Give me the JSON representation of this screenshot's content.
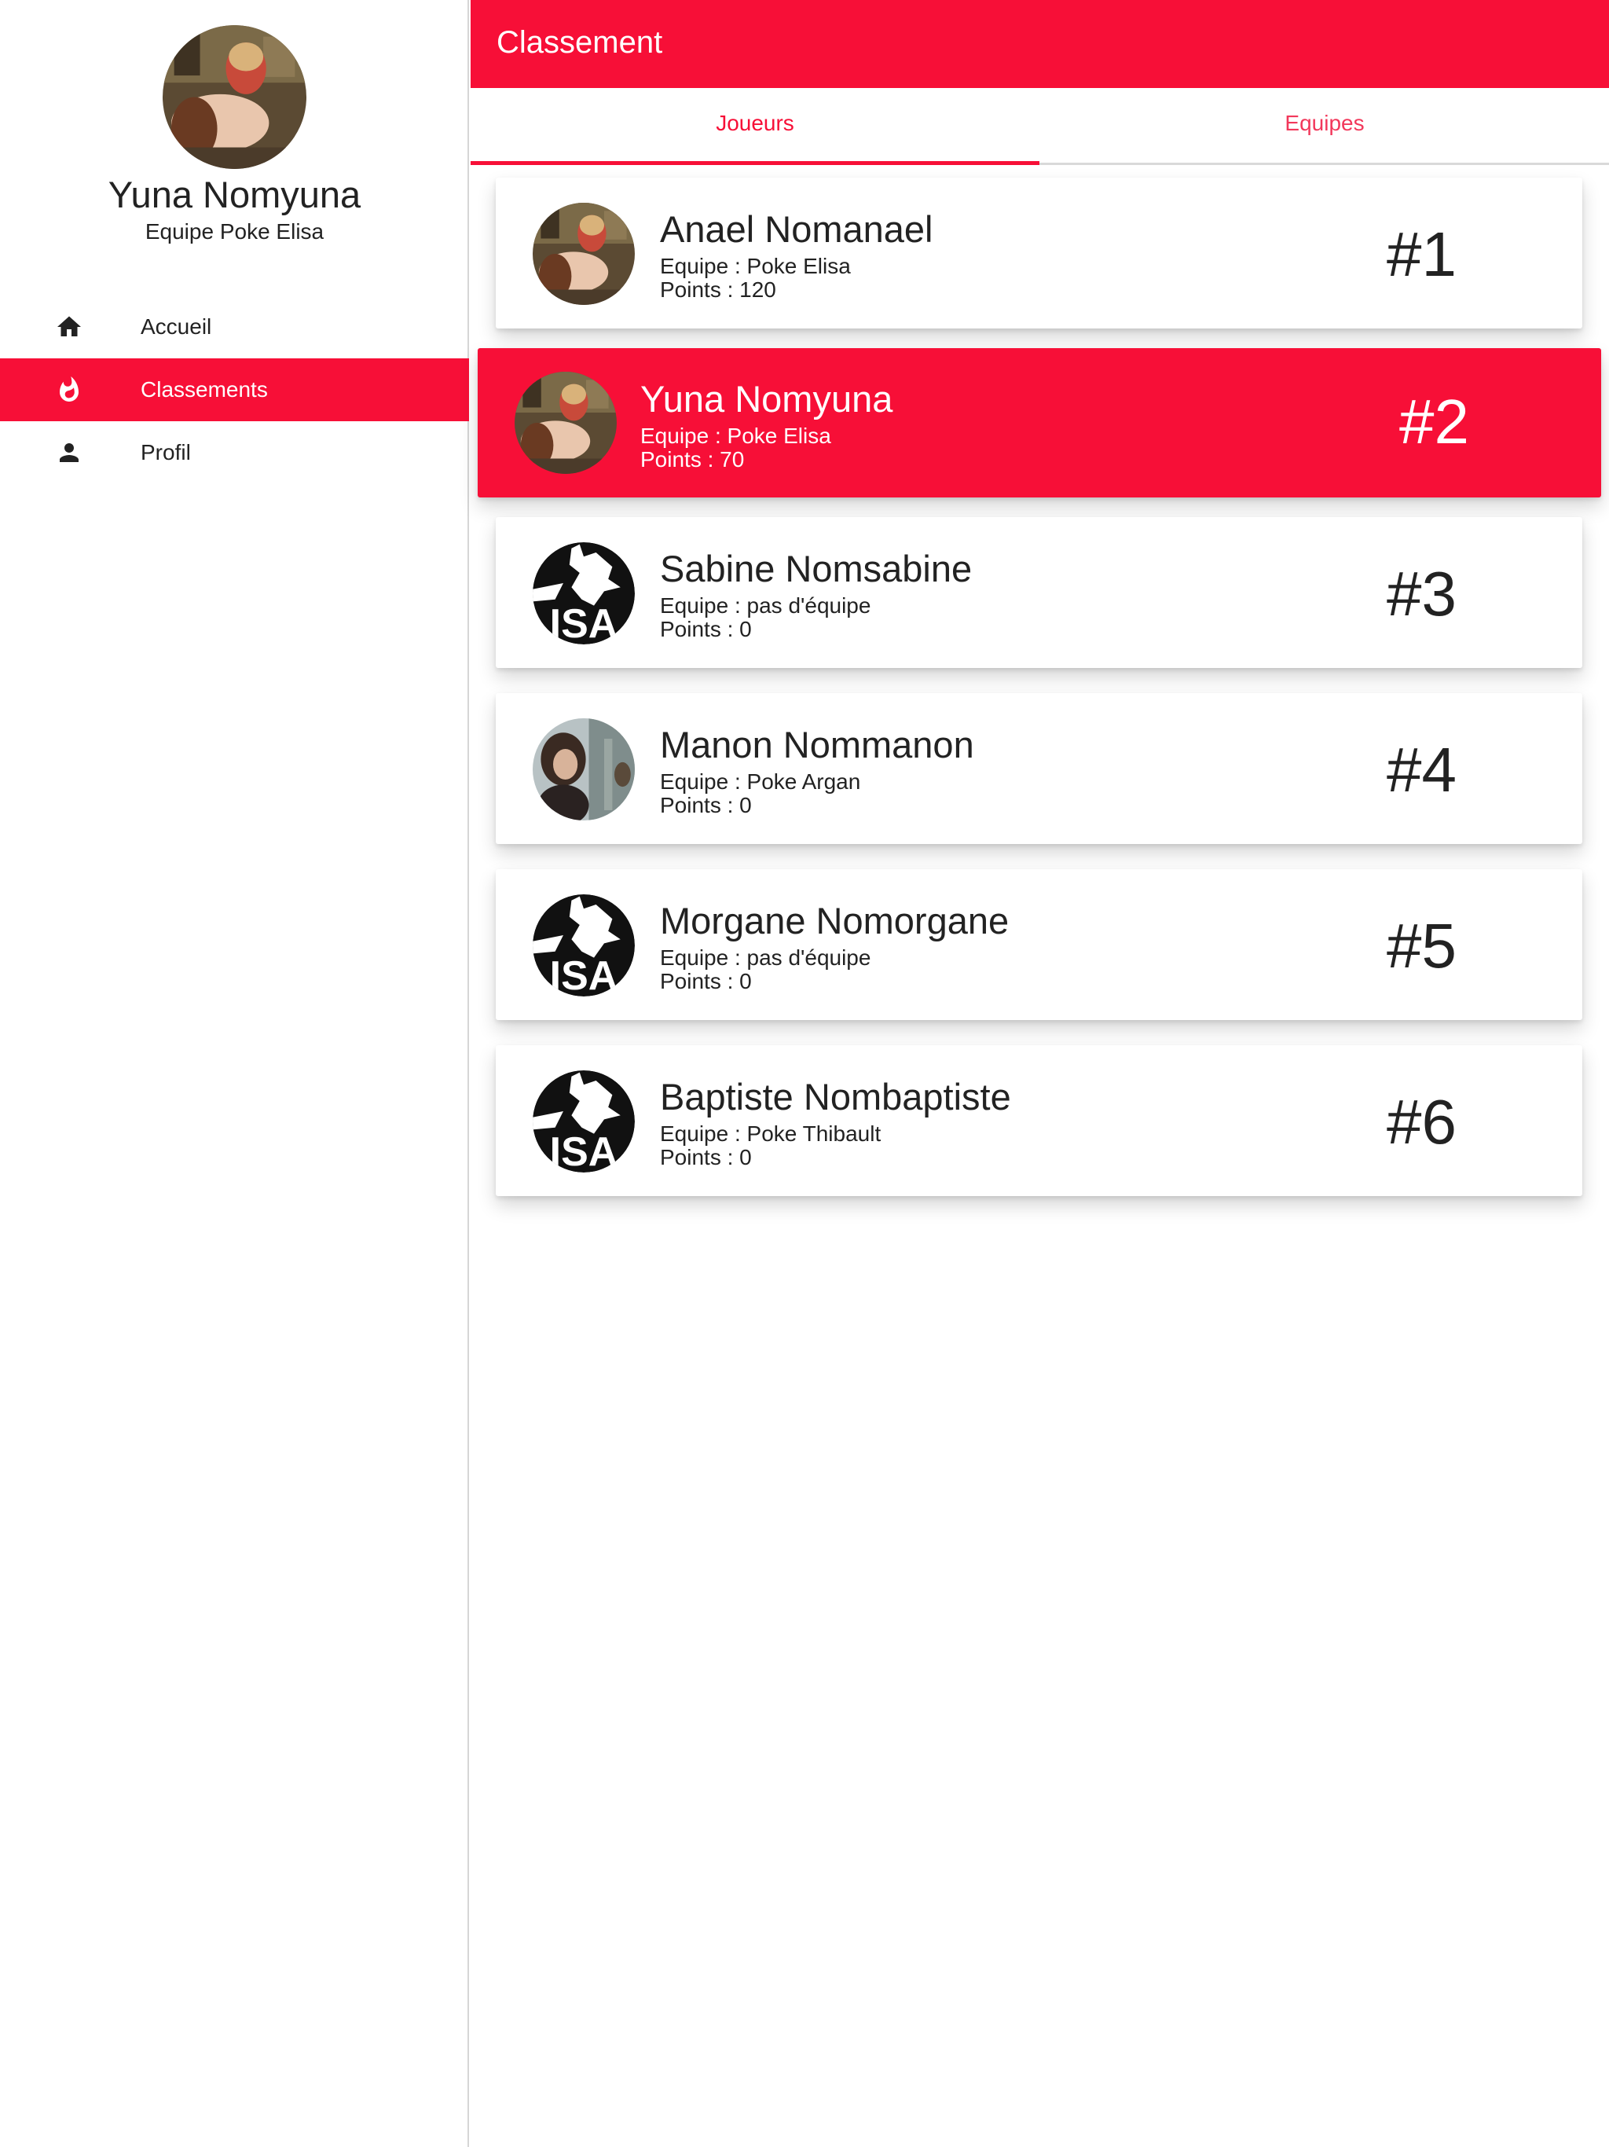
{
  "user": {
    "name": "Yuna Nomyuna",
    "team": "Equipe Poke Elisa"
  },
  "nav": {
    "items": [
      {
        "label": "Accueil",
        "icon": "home-icon",
        "active": false
      },
      {
        "label": "Classements",
        "icon": "fire-icon",
        "active": true
      },
      {
        "label": "Profil",
        "icon": "person-icon",
        "active": false
      }
    ]
  },
  "header": {
    "title": "Classement"
  },
  "tabs": [
    {
      "label": "Joueurs",
      "active": true
    },
    {
      "label": "Equipes",
      "active": false
    }
  ],
  "players": [
    {
      "name": "Anael Nomanael",
      "team": "Equipe : Poke Elisa",
      "points": "Points : 120",
      "rank": "#1",
      "avatar": "photo-avatar-bread",
      "highlight": false
    },
    {
      "name": "Yuna Nomyuna",
      "team": "Equipe : Poke Elisa",
      "points": "Points : 70",
      "rank": "#2",
      "avatar": "photo-avatar-bread",
      "highlight": true
    },
    {
      "name": "Sabine Nomsabine",
      "team": "Equipe : pas d'équipe",
      "points": "Points : 0",
      "rank": "#3",
      "avatar": "insa-logo",
      "highlight": false
    },
    {
      "name": "Manon Nommanon",
      "team": "Equipe : Poke Argan",
      "points": "Points : 0",
      "rank": "#4",
      "avatar": "photo-avatar-portrait",
      "highlight": false
    },
    {
      "name": "Morgane Nomorgane",
      "team": "Equipe : pas d'équipe",
      "points": "Points : 0",
      "rank": "#5",
      "avatar": "insa-logo",
      "highlight": false
    },
    {
      "name": "Baptiste Nombaptiste",
      "team": "Equipe : Poke Thibault",
      "points": "Points : 0",
      "rank": "#6",
      "avatar": "insa-logo",
      "highlight": false
    }
  ],
  "colors": {
    "accent": "#f70f37",
    "tab_inactive": "#f2385b",
    "text": "#222222"
  }
}
